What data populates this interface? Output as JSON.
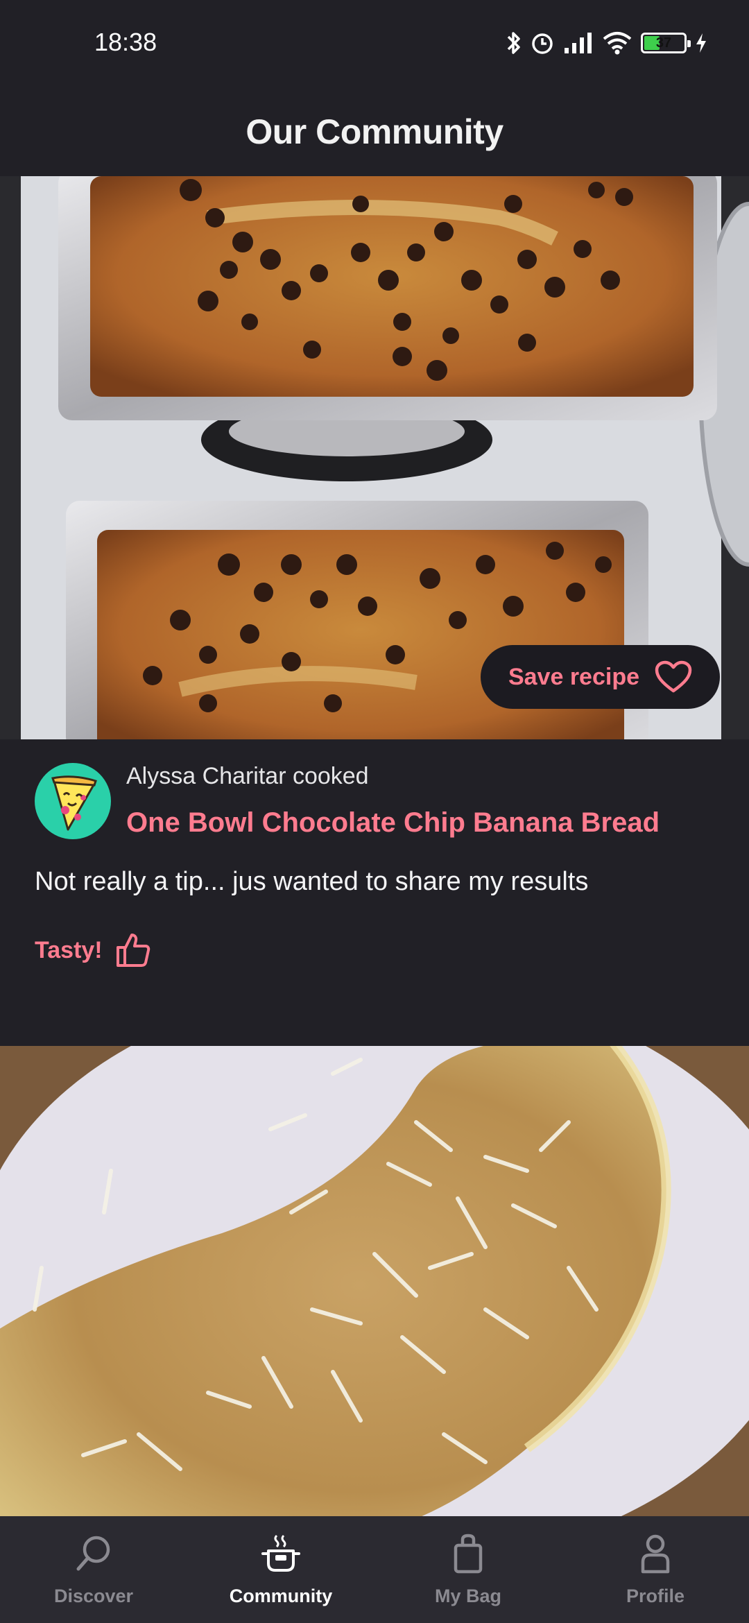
{
  "status_bar": {
    "time": "18:38",
    "battery": "37"
  },
  "header": {
    "title": "Our Community"
  },
  "post": {
    "save_label": "Save recipe",
    "author_line": "Alyssa Charitar cooked",
    "recipe_title": "One Bowl Chocolate Chip Banana Bread",
    "tip": "Not really a tip... jus wanted to share my results",
    "reaction_label": "Tasty!"
  },
  "nav": {
    "items": [
      {
        "label": "Discover",
        "icon": "search-icon",
        "active": false
      },
      {
        "label": "Community",
        "icon": "cooking-pot-icon",
        "active": true
      },
      {
        "label": "My Bag",
        "icon": "shopping-bag-icon",
        "active": false
      },
      {
        "label": "Profile",
        "icon": "person-icon",
        "active": false
      }
    ]
  },
  "colors": {
    "accent": "#ff7c8f",
    "background": "#212026",
    "nav_background": "#2b2a31"
  }
}
